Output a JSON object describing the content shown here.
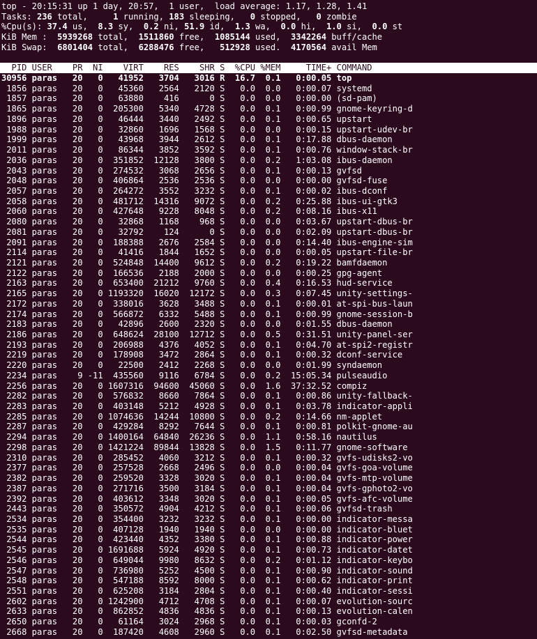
{
  "summary": {
    "line1": {
      "prefix": "top - 20:15:31 up 1 day, 20:57,  1 user,  load average: 1.17, 1.28, 1.41"
    },
    "tasks": {
      "label": "Tasks:",
      "total": "236",
      "running": "1",
      "sleeping": "183",
      "stopped": "0",
      "zombie": "0"
    },
    "cpu": {
      "label": "%Cpu(s):",
      "us": "37.4",
      "sy": "8.3",
      "ni": "0.2",
      "id": "51.9",
      "wa": "1.3",
      "hi": "0.0",
      "si": "1.0",
      "st": "0.0"
    },
    "mem": {
      "label": "KiB Mem :",
      "total": "5939268",
      "free": "1511860",
      "used": "1085144",
      "buff_cache": "3342264"
    },
    "swap": {
      "label": "KiB Swap:",
      "total": "6801404",
      "free": "6288476",
      "used": "512928",
      "avail": "4170564"
    }
  },
  "columns": [
    "PID",
    "USER",
    "PR",
    "NI",
    "VIRT",
    "RES",
    "SHR",
    "S",
    "%CPU",
    "%MEM",
    "TIME+",
    "COMMAND"
  ],
  "processes": [
    {
      "pid": "30956",
      "user": "paras",
      "pr": "20",
      "ni": "0",
      "virt": "41952",
      "res": "3704",
      "shr": "3016",
      "s": "R",
      "cpu": "16.7",
      "mem": "0.1",
      "time": "0:00.05",
      "cmd": "top",
      "bold": true
    },
    {
      "pid": "1856",
      "user": "paras",
      "pr": "20",
      "ni": "0",
      "virt": "45360",
      "res": "2564",
      "shr": "2120",
      "s": "S",
      "cpu": "0.0",
      "mem": "0.0",
      "time": "0:00.07",
      "cmd": "systemd"
    },
    {
      "pid": "1857",
      "user": "paras",
      "pr": "20",
      "ni": "0",
      "virt": "63880",
      "res": "416",
      "shr": "0",
      "s": "S",
      "cpu": "0.0",
      "mem": "0.0",
      "time": "0:00.00",
      "cmd": "(sd-pam)"
    },
    {
      "pid": "1865",
      "user": "paras",
      "pr": "20",
      "ni": "0",
      "virt": "205300",
      "res": "5340",
      "shr": "4728",
      "s": "S",
      "cpu": "0.0",
      "mem": "0.1",
      "time": "0:00.99",
      "cmd": "gnome-keyring-d"
    },
    {
      "pid": "1896",
      "user": "paras",
      "pr": "20",
      "ni": "0",
      "virt": "46444",
      "res": "3440",
      "shr": "2492",
      "s": "S",
      "cpu": "0.0",
      "mem": "0.1",
      "time": "0:00.65",
      "cmd": "upstart"
    },
    {
      "pid": "1988",
      "user": "paras",
      "pr": "20",
      "ni": "0",
      "virt": "32860",
      "res": "1696",
      "shr": "1568",
      "s": "S",
      "cpu": "0.0",
      "mem": "0.0",
      "time": "0:00.15",
      "cmd": "upstart-udev-br"
    },
    {
      "pid": "1999",
      "user": "paras",
      "pr": "20",
      "ni": "0",
      "virt": "43968",
      "res": "3944",
      "shr": "2612",
      "s": "S",
      "cpu": "0.0",
      "mem": "0.1",
      "time": "0:17.88",
      "cmd": "dbus-daemon"
    },
    {
      "pid": "2011",
      "user": "paras",
      "pr": "20",
      "ni": "0",
      "virt": "86344",
      "res": "3852",
      "shr": "3592",
      "s": "S",
      "cpu": "0.0",
      "mem": "0.1",
      "time": "0:00.76",
      "cmd": "window-stack-br"
    },
    {
      "pid": "2036",
      "user": "paras",
      "pr": "20",
      "ni": "0",
      "virt": "351852",
      "res": "12128",
      "shr": "3800",
      "s": "S",
      "cpu": "0.0",
      "mem": "0.2",
      "time": "1:03.08",
      "cmd": "ibus-daemon"
    },
    {
      "pid": "2043",
      "user": "paras",
      "pr": "20",
      "ni": "0",
      "virt": "274532",
      "res": "3068",
      "shr": "2656",
      "s": "S",
      "cpu": "0.0",
      "mem": "0.1",
      "time": "0:00.13",
      "cmd": "gvfsd"
    },
    {
      "pid": "2048",
      "user": "paras",
      "pr": "20",
      "ni": "0",
      "virt": "406864",
      "res": "2536",
      "shr": "2536",
      "s": "S",
      "cpu": "0.0",
      "mem": "0.0",
      "time": "0:00.00",
      "cmd": "gvfsd-fuse"
    },
    {
      "pid": "2057",
      "user": "paras",
      "pr": "20",
      "ni": "0",
      "virt": "264272",
      "res": "3552",
      "shr": "3232",
      "s": "S",
      "cpu": "0.0",
      "mem": "0.1",
      "time": "0:00.02",
      "cmd": "ibus-dconf"
    },
    {
      "pid": "2058",
      "user": "paras",
      "pr": "20",
      "ni": "0",
      "virt": "481712",
      "res": "14316",
      "shr": "9072",
      "s": "S",
      "cpu": "0.0",
      "mem": "0.2",
      "time": "0:25.88",
      "cmd": "ibus-ui-gtk3"
    },
    {
      "pid": "2060",
      "user": "paras",
      "pr": "20",
      "ni": "0",
      "virt": "427648",
      "res": "9228",
      "shr": "8048",
      "s": "S",
      "cpu": "0.0",
      "mem": "0.2",
      "time": "0:08.16",
      "cmd": "ibus-x11"
    },
    {
      "pid": "2080",
      "user": "paras",
      "pr": "20",
      "ni": "0",
      "virt": "32868",
      "res": "1168",
      "shr": "968",
      "s": "S",
      "cpu": "0.0",
      "mem": "0.0",
      "time": "0:03.67",
      "cmd": "upstart-dbus-br"
    },
    {
      "pid": "2081",
      "user": "paras",
      "pr": "20",
      "ni": "0",
      "virt": "32792",
      "res": "124",
      "shr": "0",
      "s": "S",
      "cpu": "0.0",
      "mem": "0.0",
      "time": "0:02.09",
      "cmd": "upstart-dbus-br"
    },
    {
      "pid": "2091",
      "user": "paras",
      "pr": "20",
      "ni": "0",
      "virt": "188388",
      "res": "2676",
      "shr": "2584",
      "s": "S",
      "cpu": "0.0",
      "mem": "0.0",
      "time": "0:14.40",
      "cmd": "ibus-engine-sim"
    },
    {
      "pid": "2114",
      "user": "paras",
      "pr": "20",
      "ni": "0",
      "virt": "41416",
      "res": "1844",
      "shr": "1652",
      "s": "S",
      "cpu": "0.0",
      "mem": "0.0",
      "time": "0:00.05",
      "cmd": "upstart-file-br"
    },
    {
      "pid": "2121",
      "user": "paras",
      "pr": "20",
      "ni": "0",
      "virt": "524848",
      "res": "14400",
      "shr": "9612",
      "s": "S",
      "cpu": "0.0",
      "mem": "0.2",
      "time": "0:19.22",
      "cmd": "bamfdaemon"
    },
    {
      "pid": "2122",
      "user": "paras",
      "pr": "20",
      "ni": "0",
      "virt": "166536",
      "res": "2188",
      "shr": "2000",
      "s": "S",
      "cpu": "0.0",
      "mem": "0.0",
      "time": "0:00.25",
      "cmd": "gpg-agent"
    },
    {
      "pid": "2163",
      "user": "paras",
      "pr": "20",
      "ni": "0",
      "virt": "653400",
      "res": "21212",
      "shr": "9760",
      "s": "S",
      "cpu": "0.0",
      "mem": "0.4",
      "time": "0:16.53",
      "cmd": "hud-service"
    },
    {
      "pid": "2165",
      "user": "paras",
      "pr": "20",
      "ni": "0",
      "virt": "1193320",
      "res": "16020",
      "shr": "12172",
      "s": "S",
      "cpu": "0.0",
      "mem": "0.3",
      "time": "0:07.45",
      "cmd": "unity-settings-"
    },
    {
      "pid": "2172",
      "user": "paras",
      "pr": "20",
      "ni": "0",
      "virt": "338016",
      "res": "3628",
      "shr": "3488",
      "s": "S",
      "cpu": "0.0",
      "mem": "0.1",
      "time": "0:00.01",
      "cmd": "at-spi-bus-laun"
    },
    {
      "pid": "2174",
      "user": "paras",
      "pr": "20",
      "ni": "0",
      "virt": "566872",
      "res": "6332",
      "shr": "5488",
      "s": "S",
      "cpu": "0.0",
      "mem": "0.1",
      "time": "0:00.99",
      "cmd": "gnome-session-b"
    },
    {
      "pid": "2183",
      "user": "paras",
      "pr": "20",
      "ni": "0",
      "virt": "42896",
      "res": "2600",
      "shr": "2320",
      "s": "S",
      "cpu": "0.0",
      "mem": "0.0",
      "time": "0:01.55",
      "cmd": "dbus-daemon"
    },
    {
      "pid": "2186",
      "user": "paras",
      "pr": "20",
      "ni": "0",
      "virt": "648624",
      "res": "28100",
      "shr": "12712",
      "s": "S",
      "cpu": "0.0",
      "mem": "0.5",
      "time": "0:31.51",
      "cmd": "unity-panel-ser"
    },
    {
      "pid": "2193",
      "user": "paras",
      "pr": "20",
      "ni": "0",
      "virt": "206988",
      "res": "4376",
      "shr": "4052",
      "s": "S",
      "cpu": "0.0",
      "mem": "0.1",
      "time": "0:04.70",
      "cmd": "at-spi2-registr"
    },
    {
      "pid": "2219",
      "user": "paras",
      "pr": "20",
      "ni": "0",
      "virt": "178908",
      "res": "3472",
      "shr": "2864",
      "s": "S",
      "cpu": "0.0",
      "mem": "0.1",
      "time": "0:00.32",
      "cmd": "dconf-service"
    },
    {
      "pid": "2220",
      "user": "paras",
      "pr": "20",
      "ni": "0",
      "virt": "22500",
      "res": "2412",
      "shr": "2268",
      "s": "S",
      "cpu": "0.0",
      "mem": "0.0",
      "time": "0:01.99",
      "cmd": "syndaemon"
    },
    {
      "pid": "2234",
      "user": "paras",
      "pr": "9",
      "ni": "-11",
      "virt": "435560",
      "res": "9116",
      "shr": "6784",
      "s": "S",
      "cpu": "0.0",
      "mem": "0.2",
      "time": "15:05.34",
      "cmd": "pulseaudio"
    },
    {
      "pid": "2256",
      "user": "paras",
      "pr": "20",
      "ni": "0",
      "virt": "1607316",
      "res": "94600",
      "shr": "45060",
      "s": "S",
      "cpu": "0.0",
      "mem": "1.6",
      "time": "37:32.52",
      "cmd": "compiz"
    },
    {
      "pid": "2282",
      "user": "paras",
      "pr": "20",
      "ni": "0",
      "virt": "576832",
      "res": "8660",
      "shr": "7864",
      "s": "S",
      "cpu": "0.0",
      "mem": "0.1",
      "time": "0:00.86",
      "cmd": "unity-fallback-"
    },
    {
      "pid": "2283",
      "user": "paras",
      "pr": "20",
      "ni": "0",
      "virt": "403148",
      "res": "5212",
      "shr": "4928",
      "s": "S",
      "cpu": "0.0",
      "mem": "0.1",
      "time": "0:03.78",
      "cmd": "indicator-appli"
    },
    {
      "pid": "2285",
      "user": "paras",
      "pr": "20",
      "ni": "0",
      "virt": "1074636",
      "res": "14244",
      "shr": "10800",
      "s": "S",
      "cpu": "0.0",
      "mem": "0.2",
      "time": "0:14.66",
      "cmd": "nm-applet"
    },
    {
      "pid": "2287",
      "user": "paras",
      "pr": "20",
      "ni": "0",
      "virt": "429284",
      "res": "8292",
      "shr": "7644",
      "s": "S",
      "cpu": "0.0",
      "mem": "0.1",
      "time": "0:00.81",
      "cmd": "polkit-gnome-au"
    },
    {
      "pid": "2294",
      "user": "paras",
      "pr": "20",
      "ni": "0",
      "virt": "1400164",
      "res": "64840",
      "shr": "26236",
      "s": "S",
      "cpu": "0.0",
      "mem": "1.1",
      "time": "0:58.16",
      "cmd": "nautilus"
    },
    {
      "pid": "2298",
      "user": "paras",
      "pr": "20",
      "ni": "0",
      "virt": "1421224",
      "res": "89844",
      "shr": "13828",
      "s": "S",
      "cpu": "0.0",
      "mem": "1.5",
      "time": "0:11.77",
      "cmd": "gnome-software"
    },
    {
      "pid": "2310",
      "user": "paras",
      "pr": "20",
      "ni": "0",
      "virt": "285452",
      "res": "4060",
      "shr": "3212",
      "s": "S",
      "cpu": "0.0",
      "mem": "0.1",
      "time": "0:00.32",
      "cmd": "gvfs-udisks2-vo"
    },
    {
      "pid": "2377",
      "user": "paras",
      "pr": "20",
      "ni": "0",
      "virt": "257528",
      "res": "2668",
      "shr": "2496",
      "s": "S",
      "cpu": "0.0",
      "mem": "0.0",
      "time": "0:00.04",
      "cmd": "gvfs-goa-volume"
    },
    {
      "pid": "2382",
      "user": "paras",
      "pr": "20",
      "ni": "0",
      "virt": "259520",
      "res": "3328",
      "shr": "3020",
      "s": "S",
      "cpu": "0.0",
      "mem": "0.1",
      "time": "0:00.04",
      "cmd": "gvfs-mtp-volume"
    },
    {
      "pid": "2387",
      "user": "paras",
      "pr": "20",
      "ni": "0",
      "virt": "271716",
      "res": "3500",
      "shr": "3184",
      "s": "S",
      "cpu": "0.0",
      "mem": "0.1",
      "time": "0:00.04",
      "cmd": "gvfs-gphoto2-vo"
    },
    {
      "pid": "2392",
      "user": "paras",
      "pr": "20",
      "ni": "0",
      "virt": "403612",
      "res": "3348",
      "shr": "3020",
      "s": "S",
      "cpu": "0.0",
      "mem": "0.1",
      "time": "0:00.05",
      "cmd": "gvfs-afc-volume"
    },
    {
      "pid": "2443",
      "user": "paras",
      "pr": "20",
      "ni": "0",
      "virt": "350572",
      "res": "4904",
      "shr": "4212",
      "s": "S",
      "cpu": "0.0",
      "mem": "0.1",
      "time": "0:00.06",
      "cmd": "gvfsd-trash"
    },
    {
      "pid": "2534",
      "user": "paras",
      "pr": "20",
      "ni": "0",
      "virt": "354400",
      "res": "3232",
      "shr": "3232",
      "s": "S",
      "cpu": "0.0",
      "mem": "0.1",
      "time": "0:00.00",
      "cmd": "indicator-messa"
    },
    {
      "pid": "2535",
      "user": "paras",
      "pr": "20",
      "ni": "0",
      "virt": "407128",
      "res": "1940",
      "shr": "1940",
      "s": "S",
      "cpu": "0.0",
      "mem": "0.0",
      "time": "0:00.00",
      "cmd": "indicator-bluet"
    },
    {
      "pid": "2544",
      "user": "paras",
      "pr": "20",
      "ni": "0",
      "virt": "423440",
      "res": "4352",
      "shr": "3380",
      "s": "S",
      "cpu": "0.0",
      "mem": "0.1",
      "time": "0:00.88",
      "cmd": "indicator-power"
    },
    {
      "pid": "2545",
      "user": "paras",
      "pr": "20",
      "ni": "0",
      "virt": "1691688",
      "res": "5924",
      "shr": "4920",
      "s": "S",
      "cpu": "0.0",
      "mem": "0.1",
      "time": "0:00.73",
      "cmd": "indicator-datet"
    },
    {
      "pid": "2546",
      "user": "paras",
      "pr": "20",
      "ni": "0",
      "virt": "649044",
      "res": "9980",
      "shr": "8632",
      "s": "S",
      "cpu": "0.0",
      "mem": "0.2",
      "time": "0:01.12",
      "cmd": "indicator-keybo"
    },
    {
      "pid": "2547",
      "user": "paras",
      "pr": "20",
      "ni": "0",
      "virt": "736980",
      "res": "5252",
      "shr": "4500",
      "s": "S",
      "cpu": "0.0",
      "mem": "0.1",
      "time": "0:00.90",
      "cmd": "indicator-sound"
    },
    {
      "pid": "2548",
      "user": "paras",
      "pr": "20",
      "ni": "0",
      "virt": "547188",
      "res": "8592",
      "shr": "8000",
      "s": "S",
      "cpu": "0.0",
      "mem": "0.1",
      "time": "0:00.62",
      "cmd": "indicator-print"
    },
    {
      "pid": "2551",
      "user": "paras",
      "pr": "20",
      "ni": "0",
      "virt": "625208",
      "res": "3184",
      "shr": "2804",
      "s": "S",
      "cpu": "0.0",
      "mem": "0.1",
      "time": "0:00.40",
      "cmd": "indicator-sessi"
    },
    {
      "pid": "2602",
      "user": "paras",
      "pr": "20",
      "ni": "0",
      "virt": "1242900",
      "res": "4712",
      "shr": "4708",
      "s": "S",
      "cpu": "0.0",
      "mem": "0.1",
      "time": "0:00.07",
      "cmd": "evolution-sourc"
    },
    {
      "pid": "2633",
      "user": "paras",
      "pr": "20",
      "ni": "0",
      "virt": "862852",
      "res": "4836",
      "shr": "4836",
      "s": "S",
      "cpu": "0.0",
      "mem": "0.1",
      "time": "0:00.13",
      "cmd": "evolution-calen"
    },
    {
      "pid": "2650",
      "user": "paras",
      "pr": "20",
      "ni": "0",
      "virt": "61164",
      "res": "3024",
      "shr": "2968",
      "s": "S",
      "cpu": "0.0",
      "mem": "0.1",
      "time": "0:00.03",
      "cmd": "gconfd-2"
    },
    {
      "pid": "2668",
      "user": "paras",
      "pr": "20",
      "ni": "0",
      "virt": "187420",
      "res": "4608",
      "shr": "2960",
      "s": "S",
      "cpu": "0.0",
      "mem": "0.1",
      "time": "0:02.50",
      "cmd": "gvfsd-metadata"
    }
  ]
}
